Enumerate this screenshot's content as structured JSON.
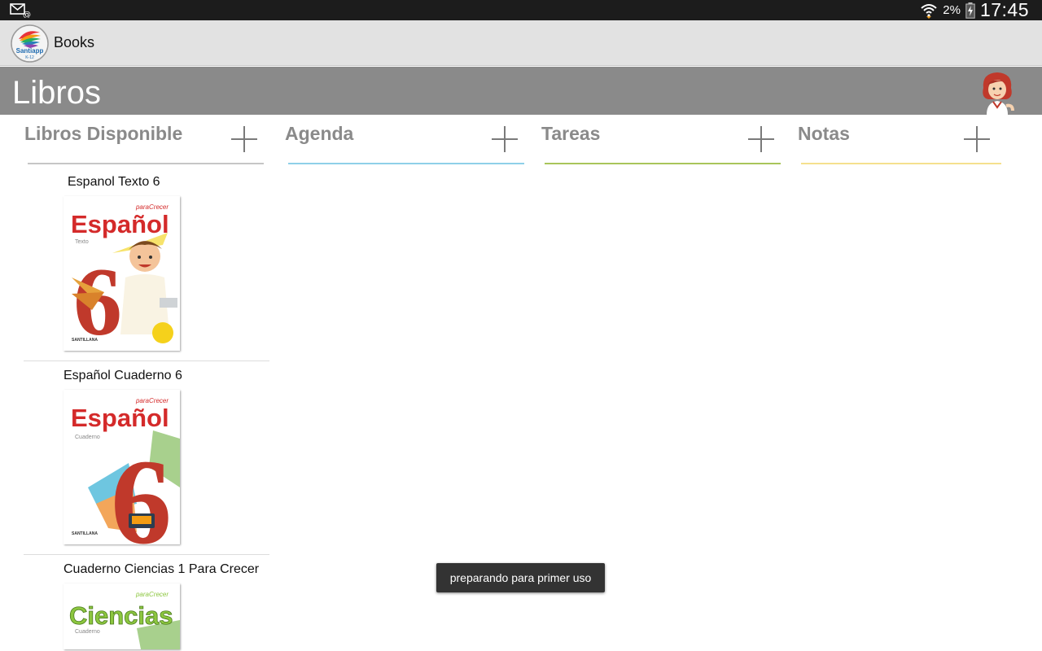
{
  "status_bar": {
    "icons": [
      "mail-at-icon",
      "wifi-icon",
      "battery-charging-icon"
    ],
    "battery": "2%",
    "time": "17:45"
  },
  "action_bar": {
    "logo_text": "Santiapp",
    "logo_subtext": "K-12",
    "title": "Books"
  },
  "header": {
    "title": "Libros"
  },
  "columns": [
    {
      "title": "Libros Disponible",
      "color": "#c6c6c6"
    },
    {
      "title": "Agenda",
      "color": "#8fd0e8"
    },
    {
      "title": "Tareas",
      "color": "#a9c55a"
    },
    {
      "title": "Notas",
      "color": "#f5e08e"
    }
  ],
  "books": [
    {
      "title": "Espanol Texto 6",
      "cover": {
        "series": "paraCrecer",
        "subject": "Español",
        "kind": "Texto",
        "number": "6",
        "publisher": "SANTILLANA",
        "accent": "#d42a2a"
      }
    },
    {
      "title": "Español Cuaderno 6",
      "cover": {
        "series": "paraCrecer",
        "subject": "Español",
        "kind": "Cuaderno",
        "number": "6",
        "publisher": "SANTILLANA",
        "accent": "#d42a2a"
      }
    },
    {
      "title": "Cuaderno Ciencias 1 Para Crecer",
      "cover": {
        "series": "paraCrecer",
        "subject": "Ciencias",
        "kind": "Cuaderno",
        "number": "",
        "publisher": "",
        "accent": "#8cc63f"
      }
    }
  ],
  "toast": {
    "message": "preparando para primer uso"
  }
}
